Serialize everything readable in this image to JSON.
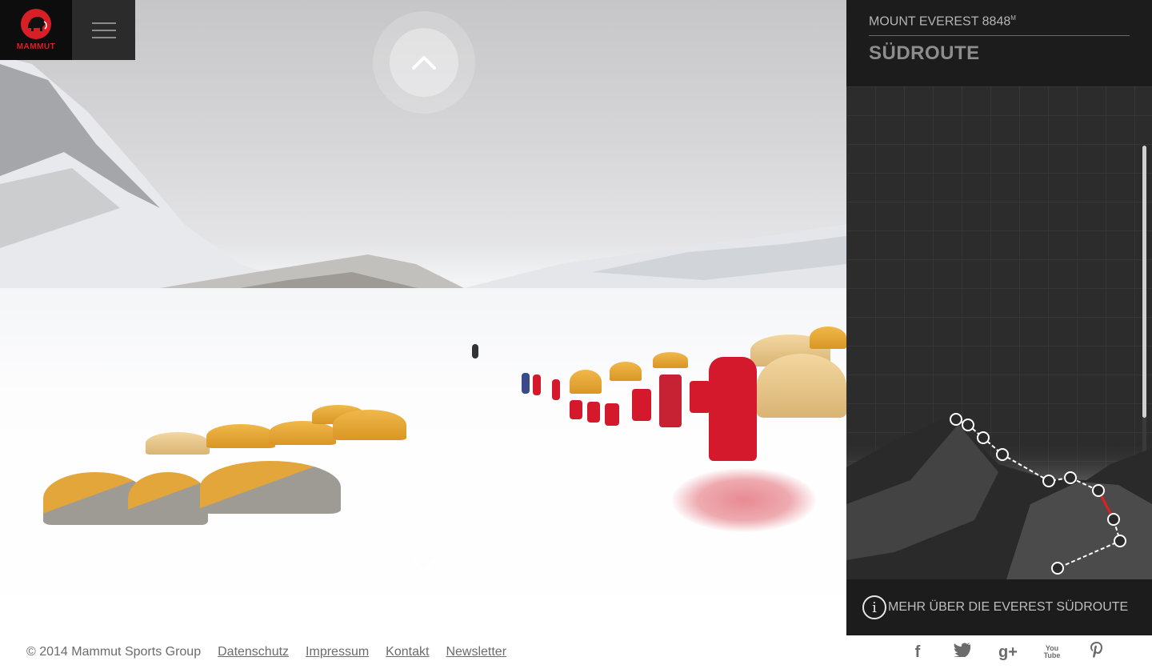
{
  "brand": {
    "logo_text": "MAMMUT"
  },
  "panel": {
    "subtitle": "MOUNT EVEREST 8848",
    "subtitle_unit": "M",
    "title": "SÜDROUTE",
    "info_text": "MEHR ÜBER DIE EVEREST SÜDROUTE"
  },
  "footer": {
    "copyright": "© 2014 Mammut Sports Group",
    "links": [
      "Datenschutz",
      "Impressum",
      "Kontakt",
      "Newsletter"
    ]
  },
  "social": [
    "facebook-icon",
    "twitter-icon",
    "google-plus-icon",
    "youtube-icon",
    "pinterest-icon"
  ],
  "colors": {
    "brand_red": "#d81f26",
    "panel_dark": "#1c1c1c",
    "route_highlight": "#e02020"
  }
}
